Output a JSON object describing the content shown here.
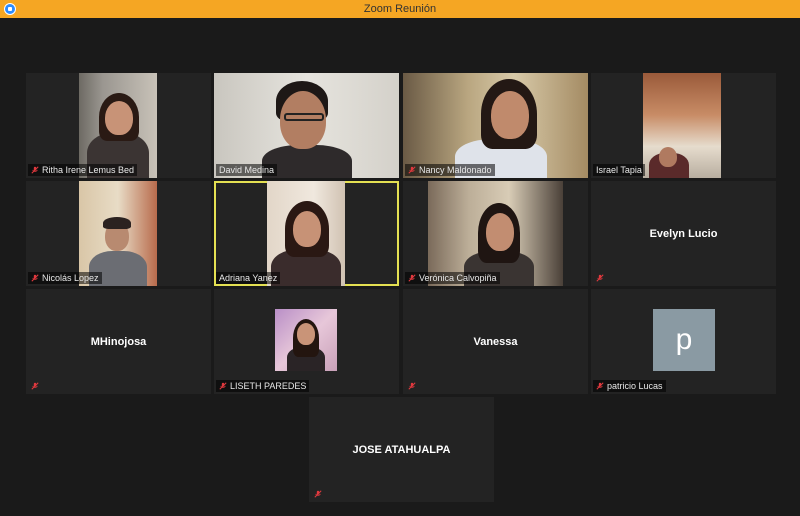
{
  "window": {
    "title": "Zoom Reunión"
  },
  "participants": [
    {
      "name": "Ritha Irene Lemus Bed",
      "muted": true
    },
    {
      "name": "David Medina",
      "muted": false
    },
    {
      "name": "Nancy Maldonado",
      "muted": true
    },
    {
      "name": "Israel Tapia",
      "muted": false
    },
    {
      "name": "Nicolás Lopez",
      "muted": true
    },
    {
      "name": "Adriana Yanez",
      "muted": false,
      "active_speaker": true
    },
    {
      "name": "Verónica Calvopiña",
      "muted": true
    },
    {
      "name": "Evelyn Lucio",
      "muted": true,
      "video_off": true
    },
    {
      "name": "MHinojosa",
      "muted": true,
      "video_off": true
    },
    {
      "name": "LISETH PAREDES",
      "muted": true
    },
    {
      "name": "Vanessa",
      "muted": true,
      "video_off": true
    },
    {
      "name": "patricio Lucas",
      "muted": true,
      "video_off": true,
      "avatar_letter": "p"
    },
    {
      "name": "JOSE ATAHUALPA",
      "muted": true,
      "video_off": true
    }
  ],
  "colors": {
    "titlebar": "#f5a623",
    "background": "#1a1a1a",
    "tile": "#232323",
    "active_border": "#e4e052",
    "mute_red": "#e0393e"
  }
}
